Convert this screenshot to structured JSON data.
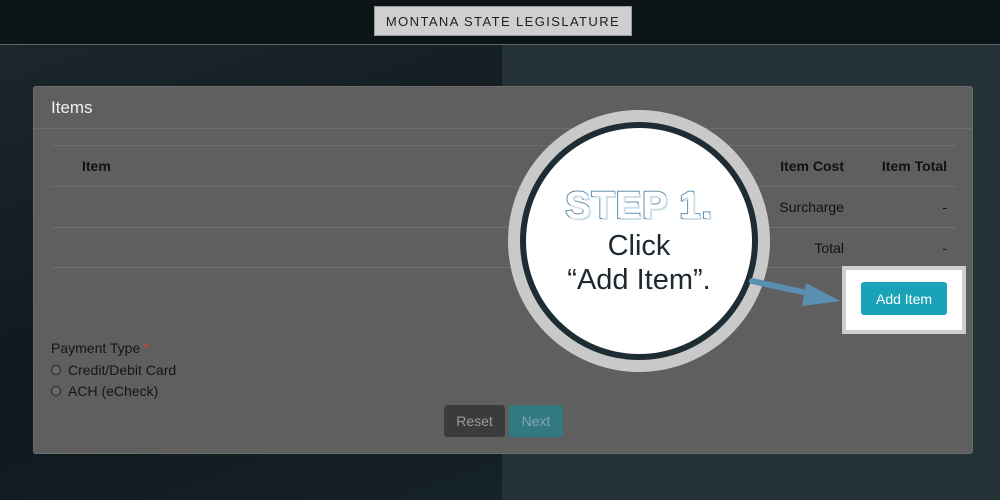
{
  "header": {
    "banner": "MONTANA STATE LEGISLATURE"
  },
  "card": {
    "title": "Items",
    "columns": {
      "item": "Item",
      "item_cost": "Item Cost",
      "item_total": "Item Total"
    },
    "rows": [
      {
        "label": "Surcharge",
        "value": "-"
      },
      {
        "label": "Total",
        "value": "-"
      }
    ],
    "add_item_label": "Add Item"
  },
  "payment": {
    "label": "Payment Type",
    "required_mark": "*",
    "options": [
      "Credit/Debit Card",
      "ACH (eCheck)"
    ]
  },
  "actions": {
    "reset_label": "Reset",
    "next_label": "Next"
  },
  "callout": {
    "title": "STEP 1.",
    "line1": "Click",
    "line2": "“Add Item”."
  },
  "colors": {
    "accent_button": "#1aa3b8",
    "callout_title_outline": "#5d8fb0",
    "required": "#e23a3a"
  }
}
